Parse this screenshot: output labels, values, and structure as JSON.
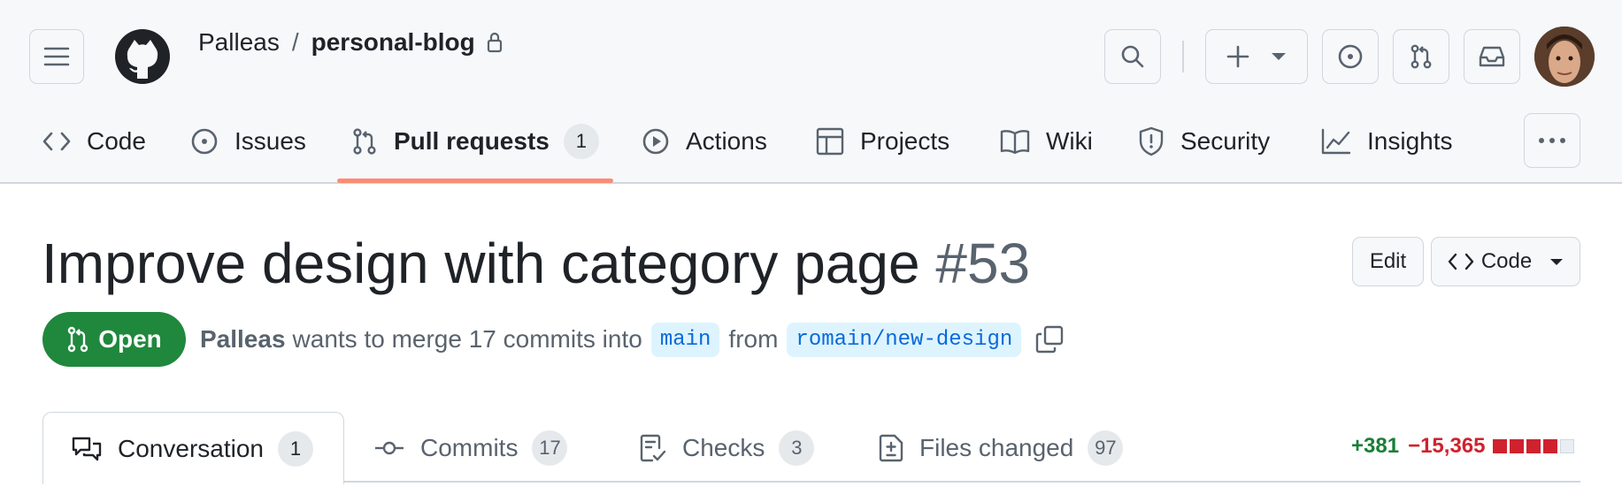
{
  "header": {
    "owner": "Palleas",
    "separator": "/",
    "repo": "personal-blog"
  },
  "nav": {
    "items": [
      {
        "label": "Code"
      },
      {
        "label": "Issues"
      },
      {
        "label": "Pull requests",
        "count": "1"
      },
      {
        "label": "Actions"
      },
      {
        "label": "Projects"
      },
      {
        "label": "Wiki"
      },
      {
        "label": "Security"
      },
      {
        "label": "Insights"
      }
    ]
  },
  "pr": {
    "title": "Improve design with category page",
    "number": "#53",
    "edit_label": "Edit",
    "code_label": "Code",
    "state": "Open",
    "author": "Palleas",
    "merge_text": "wants to merge 17 commits into",
    "base_branch": "main",
    "from_text": "from",
    "head_branch": "romain/new-design"
  },
  "tabs": [
    {
      "label": "Conversation",
      "count": "1"
    },
    {
      "label": "Commits",
      "count": "17"
    },
    {
      "label": "Checks",
      "count": "3"
    },
    {
      "label": "Files changed",
      "count": "97"
    }
  ],
  "diffstat": {
    "additions": "+381",
    "deletions": "−15,365",
    "blocks": [
      "deleted",
      "deleted",
      "deleted",
      "deleted",
      "neutral"
    ]
  },
  "colors": {
    "open_green": "#1f883d",
    "additions": "#1a7f37",
    "deletions": "#cf222e",
    "underline_accent": "#fd8c73",
    "branch_bg": "#ddf4ff",
    "branch_fg": "#0969da"
  }
}
